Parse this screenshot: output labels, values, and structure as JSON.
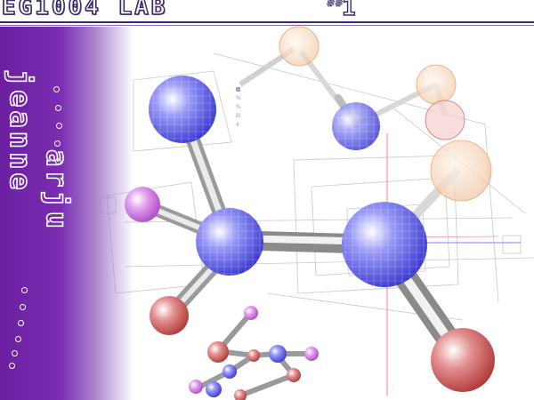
{
  "header": {
    "title": "EG1004 LAB",
    "mark": "##",
    "number": "1"
  },
  "author": {
    "first_name": "jeanne",
    "last_name": "arju"
  },
  "artwork": {
    "subject": "molecule-model-render",
    "colors": {
      "panel_purple": "#7b2cb2",
      "atom_blue": "#5a5af0",
      "atom_red": "#d05050",
      "atom_pink": "#d070e0",
      "atom_peach": "#f0b080",
      "title_outline": "#3a2a6a"
    }
  }
}
